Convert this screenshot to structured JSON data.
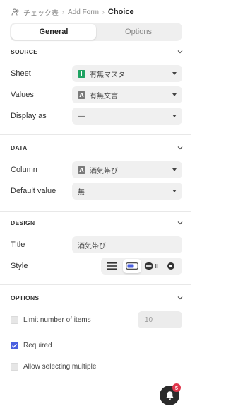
{
  "breadcrumb": {
    "items": [
      "チェック表",
      "Add Form"
    ],
    "current": "Choice",
    "icon": "people-icon"
  },
  "tabs": [
    {
      "label": "General",
      "active": true
    },
    {
      "label": "Options",
      "active": false
    }
  ],
  "source": {
    "title": "SOURCE",
    "sheet_label": "Sheet",
    "sheet_value": "有無マスタ",
    "values_label": "Values",
    "values_value": "有無文言",
    "display_label": "Display as",
    "display_value": "—"
  },
  "data_section": {
    "title": "DATA",
    "column_label": "Column",
    "column_value": "酒気帯び",
    "default_label": "Default value",
    "default_value": "無"
  },
  "design": {
    "title": "DESIGN",
    "title_label": "Title",
    "title_value": "酒気帯び",
    "style_label": "Style",
    "style_options": [
      "list-style-icon",
      "toggle-style-icon",
      "segmented-style-icon",
      "radio-style-icon"
    ],
    "style_selected": "toggle-style-icon"
  },
  "options": {
    "title": "OPTIONS",
    "limit_label": "Limit number of items",
    "limit_checked": false,
    "limit_placeholder": "10",
    "required_label": "Required",
    "required_checked": true,
    "multiple_label": "Allow selecting multiple",
    "multiple_checked": false
  },
  "notifications": {
    "count": "5",
    "icon": "bell-icon"
  },
  "colors": {
    "accent": "#4a5fe0",
    "sheet_icon": "#1ea362",
    "badge": "#e0354a"
  }
}
